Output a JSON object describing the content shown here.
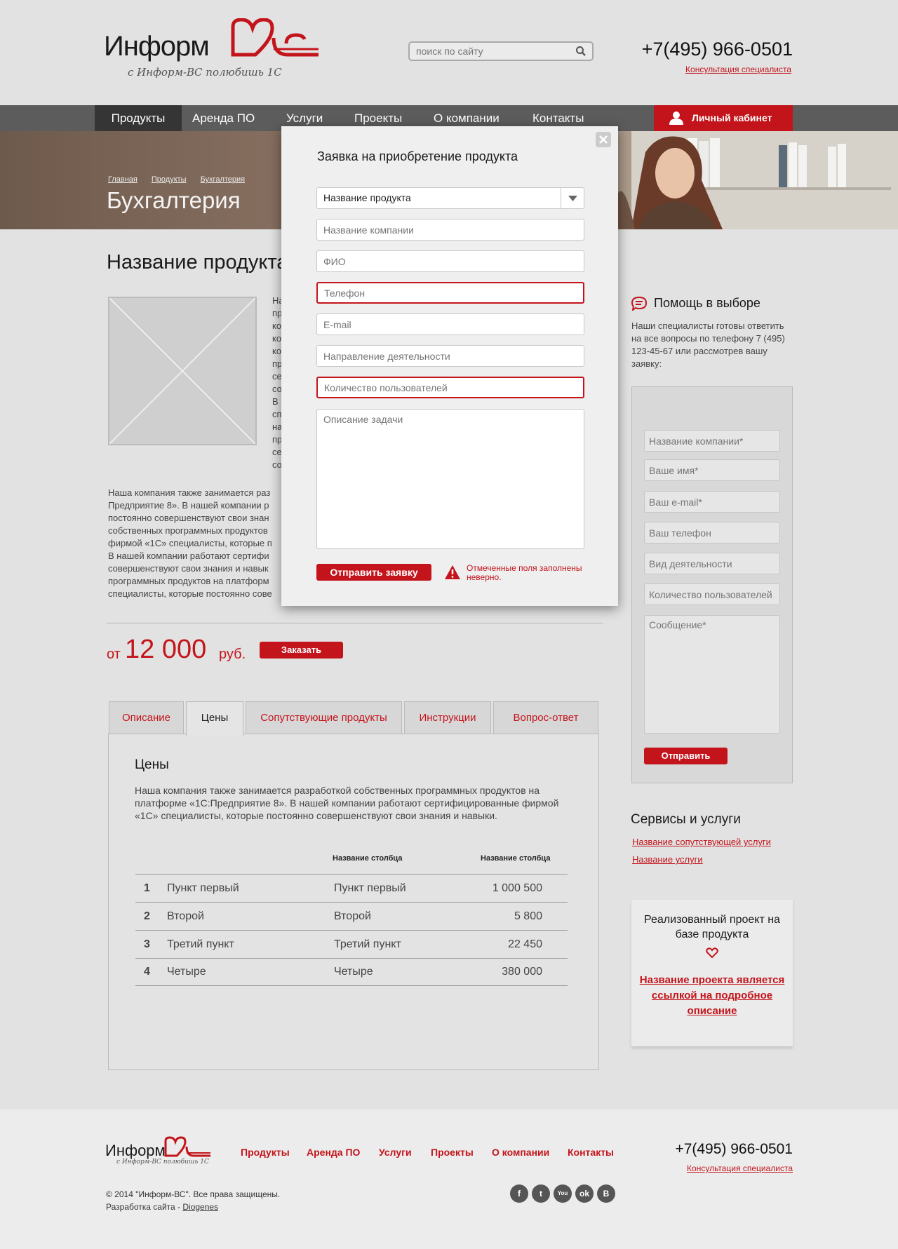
{
  "header": {
    "logo_brand": "Информ",
    "logo_slogan": "с Информ-ВС полюбишь 1С",
    "search_placeholder": "поиск по сайту",
    "phone": "+7(495) 966-0501",
    "consult_link": "Консультация специалиста"
  },
  "nav": {
    "items": [
      {
        "label": "Продукты",
        "active": true
      },
      {
        "label": "Аренда ПО"
      },
      {
        "label": "Услуги"
      },
      {
        "label": "Проекты"
      },
      {
        "label": "О компании"
      },
      {
        "label": "Контакты"
      }
    ],
    "cabinet_label": "Личный кабинет"
  },
  "banner": {
    "breadcrumbs": [
      "Главная",
      "Продукты",
      "Бухгалтерия"
    ],
    "title": "Бухгалтерия"
  },
  "product": {
    "title": "Название продукта",
    "description_lines": [
      "На",
      "пр",
      "ко",
      "ко",
      "ко",
      "пр",
      "се",
      "со",
      "В",
      "сп",
      "на",
      "пр",
      "се",
      "со"
    ],
    "extra_lines": [
      "Наша компания также занимается раз",
      "Предприятие 8». В нашей компании р",
      "постоянно совершенствуют свои знан",
      "собственных программных продуктов",
      "фирмой «1С» специалисты, которые п",
      "В нашей компании работают сертифи",
      "совершенствуют свои знания и навык",
      "программных продуктов на платформ",
      "специалисты, которые постоянно сове"
    ],
    "price_from": "от",
    "price_value": "12 000",
    "price_currency": "руб.",
    "order_label": "Заказать"
  },
  "tabs": {
    "items": [
      {
        "label": "Описание"
      },
      {
        "label": "Цены",
        "active": true
      },
      {
        "label": "Сопутствующие продукты"
      },
      {
        "label": "Инструкции"
      },
      {
        "label": "Вопрос-ответ"
      }
    ],
    "panel_title": "Цены",
    "panel_text": "Наша компания также занимается разработкой собственных программных продуктов на платформе «1С:Предприятие 8». В нашей компании работают сертифицированные фирмой «1С» специалисты, которые постоянно совершенствуют свои знания и навыки.",
    "table": {
      "headers": [
        "Название столбца",
        "Название столбца"
      ],
      "rows": [
        {
          "n": "1",
          "a": "Пункт первый",
          "b": "Пункт первый",
          "c": "1 000 500"
        },
        {
          "n": "2",
          "a": "Второй",
          "b": "Второй",
          "c": "5 800"
        },
        {
          "n": "3",
          "a": "Третий пункт",
          "b": "Третий пункт",
          "c": "22 450"
        },
        {
          "n": "4",
          "a": "Четыре",
          "b": "Четыре",
          "c": "380 000"
        }
      ]
    }
  },
  "sidebar": {
    "help_title": "Помощь в выборе",
    "help_text": "Наши специалисты готовы ответить на все вопросы по телефону 7 (495) 123-45-67 или рассмотрев вашу заявку:",
    "form": {
      "fields": [
        "Название компании*",
        "Ваше имя*",
        "Ваш e-mail*",
        "Ваш телефон",
        "Вид деятельности",
        "Количество пользователей"
      ],
      "message_placeholder": "Сообщение*",
      "send_label": "Отправить"
    },
    "services_title": "Сервисы и услуги",
    "services_links": [
      "Название сопутствующей услуги",
      "Название услуги"
    ],
    "project_title": "Реализованный проект на базе продукта",
    "project_link": "Название проекта является ссылкой на подробное описание"
  },
  "footer": {
    "logo_brand": "Информ",
    "logo_slogan": "с Информ-ВС полюбишь 1С",
    "nav": [
      "Продукты",
      "Аренда ПО",
      "Услуги",
      "Проекты",
      "О компании",
      "Контакты"
    ],
    "phone": "+7(495) 966-0501",
    "consult_link": "Консультация специалиста",
    "copyright": "© 2014 \"Информ-ВС\". Все права защищены.",
    "dev_prefix": "Разработка сайта - ",
    "dev_link": "Diogenes",
    "social": [
      "f",
      "t",
      "You",
      "ok",
      "В"
    ]
  },
  "modal": {
    "title": "Заявка на приобретение продукта",
    "product_select": "Название продукта",
    "fields": [
      {
        "placeholder": "Название компании",
        "error": false
      },
      {
        "placeholder": "ФИО",
        "error": false
      },
      {
        "placeholder": "Телефон",
        "error": true
      },
      {
        "placeholder": "E-mail",
        "error": false
      },
      {
        "placeholder": "Направление деятельности",
        "error": false
      },
      {
        "placeholder": "Количество пользователей",
        "error": true
      }
    ],
    "textarea_placeholder": "Описание задачи",
    "submit_label": "Отправить заявку",
    "error_text": "Отмеченные поля заполнены неверно."
  },
  "colors": {
    "accent": "#c4141b",
    "nav_bg": "#5c5c5c",
    "nav_active": "#353535"
  }
}
